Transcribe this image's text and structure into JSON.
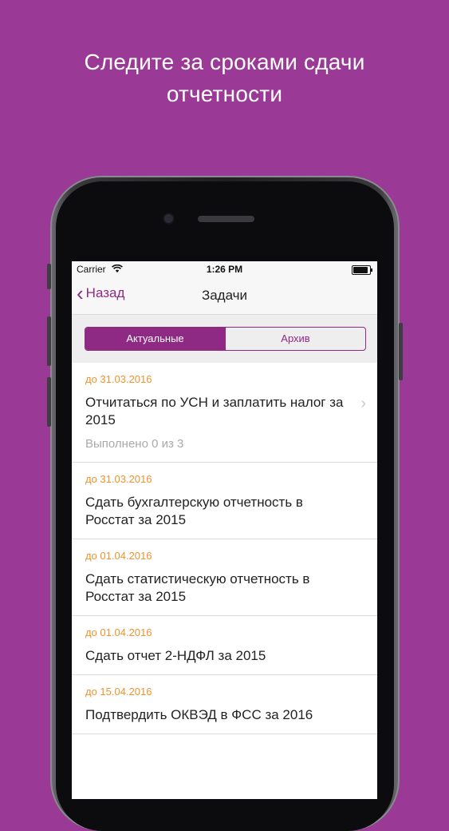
{
  "headline": {
    "line1": "Следите за сроками сдачи",
    "line2": "отчетности"
  },
  "status_bar": {
    "carrier": "Carrier",
    "time": "1:26 PM"
  },
  "nav": {
    "back_label": "Назад",
    "title": "Задачи"
  },
  "segments": {
    "active": "Актуальные",
    "archive": "Архив"
  },
  "tasks": [
    {
      "due": "до 31.03.2016",
      "title": "Отчитаться по УСН и заплатить налог за 2015",
      "progress": "Выполнено 0 из 3"
    },
    {
      "due": "до 31.03.2016",
      "title": "Сдать бухгалтерскую отчетность в Росстат за 2015"
    },
    {
      "due": "до 01.04.2016",
      "title": "Сдать статистическую отчетность в Росстат за 2015"
    },
    {
      "due": "до 01.04.2016",
      "title": "Сдать отчет 2-НДФЛ за 2015"
    },
    {
      "due": "до 15.04.2016",
      "title": "Подтвердить ОКВЭД в ФСС за 2016"
    }
  ],
  "colors": {
    "background": "#9b3a96",
    "accent": "#8e2a84",
    "due_date": "#f0922e"
  }
}
